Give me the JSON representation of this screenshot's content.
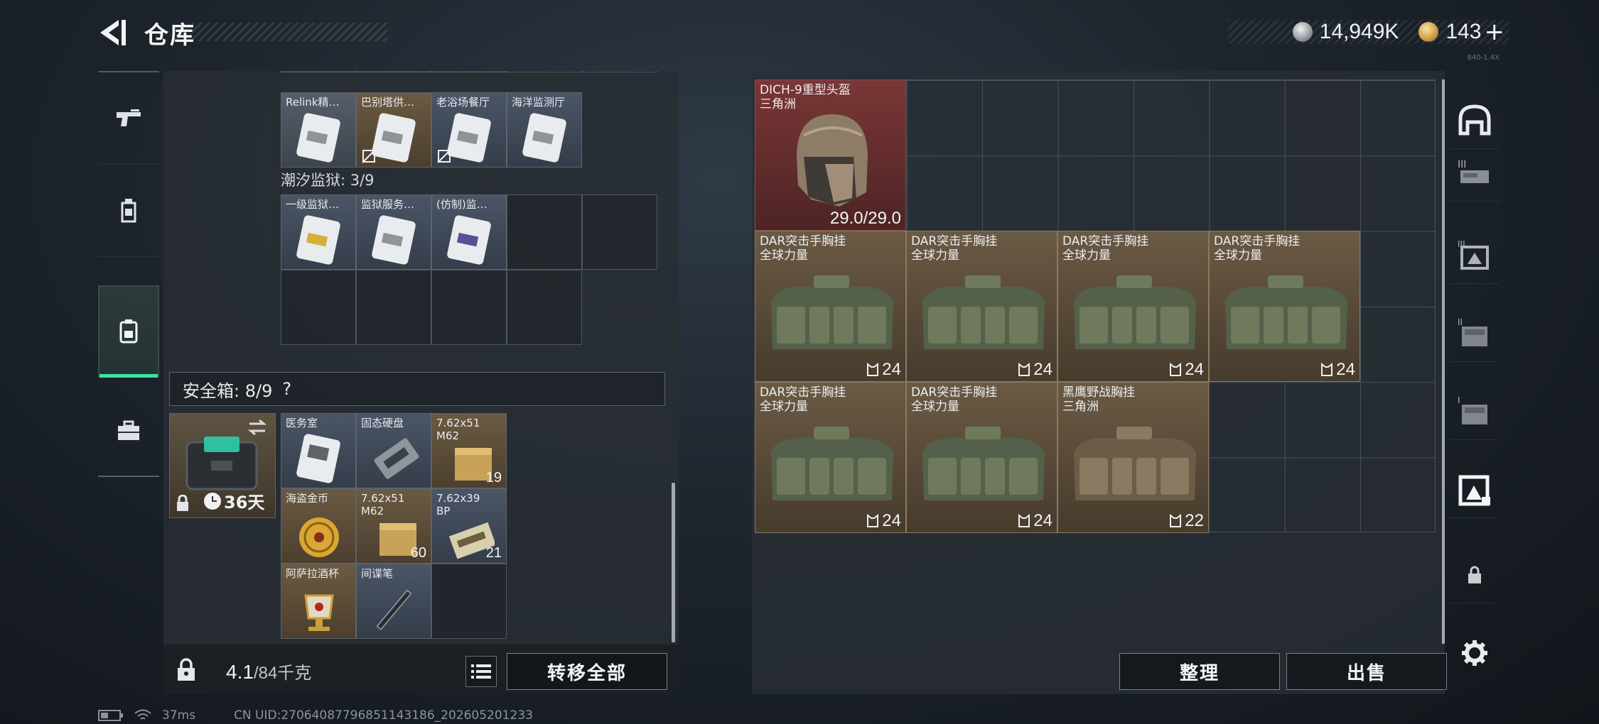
{
  "header": {
    "title": "仓库",
    "silver_amount": "14,949K",
    "gold_amount": "143",
    "plus_label": "+",
    "tiny_code": "840-1.4X"
  },
  "left_nav": {
    "items": [
      {
        "name": "weapons",
        "icon": "pistol-icon"
      },
      {
        "name": "armor",
        "icon": "backpack-icon"
      },
      {
        "name": "keys",
        "icon": "keycard-holder-icon"
      },
      {
        "name": "containers",
        "icon": "briefcase-icon"
      }
    ]
  },
  "key_section": {
    "top_row": [
      {
        "name": "Relink精…",
        "color": "gray"
      },
      {
        "name": "巴别塔供…",
        "color": "brown",
        "no_trade": true
      },
      {
        "name": "老浴场餐厅",
        "color": "blue",
        "no_trade": true
      },
      {
        "name": "海洋监测厅",
        "color": "blue"
      }
    ],
    "prison_label": "潮汐监狱: 3/9",
    "prison_row": [
      {
        "name": "一级监狱…",
        "color": "blue"
      },
      {
        "name": "监狱服务…",
        "color": "blue"
      },
      {
        "name": "(仿制)监…",
        "color": "blue"
      }
    ]
  },
  "safe_box": {
    "label": "安全箱: 8/9",
    "help": "?",
    "timer": "36天",
    "items": [
      {
        "name": "医务室",
        "qty": "",
        "color": "blue"
      },
      {
        "name": "固态硬盘",
        "qty": "",
        "color": "blue"
      },
      {
        "name": "7.62x51\nM62",
        "qty": "19",
        "color": "brown"
      },
      {
        "name": "海盗金币",
        "qty": "",
        "color": "brown"
      },
      {
        "name": "7.62x51\nM62",
        "qty": "60",
        "color": "brown"
      },
      {
        "name": "7.62x39\nBP",
        "qty": "21",
        "color": "blue"
      },
      {
        "name": "阿萨拉酒杯",
        "qty": "",
        "color": "brown"
      },
      {
        "name": "间谍笔",
        "qty": "",
        "color": "blue"
      }
    ]
  },
  "bottom_left": {
    "weight_current": "4.1",
    "weight_max": "/84千克",
    "transfer_all": "转移全部"
  },
  "stash": {
    "helmet": {
      "name": "DICH-9重型头盔\n三角洲",
      "durability": "29.0/29.0"
    },
    "rigs": [
      {
        "name": "DAR突击手胸挂\n全球力量",
        "qty": "24"
      },
      {
        "name": "DAR突击手胸挂\n全球力量",
        "qty": "24"
      },
      {
        "name": "DAR突击手胸挂\n全球力量",
        "qty": "24"
      },
      {
        "name": "DAR突击手胸挂\n全球力量",
        "qty": "24"
      },
      {
        "name": "DAR突击手胸挂\n全球力量",
        "qty": "24"
      },
      {
        "name": "DAR突击手胸挂\n全球力量",
        "qty": "24"
      },
      {
        "name": "黑鹰野战胸挂\n三角洲",
        "qty": "22"
      }
    ]
  },
  "bottom_right": {
    "organize": "整理",
    "sell": "出售"
  },
  "status_bar": {
    "ping": "37ms",
    "uid": "CN UID:27064087796851143186_202605201233"
  }
}
